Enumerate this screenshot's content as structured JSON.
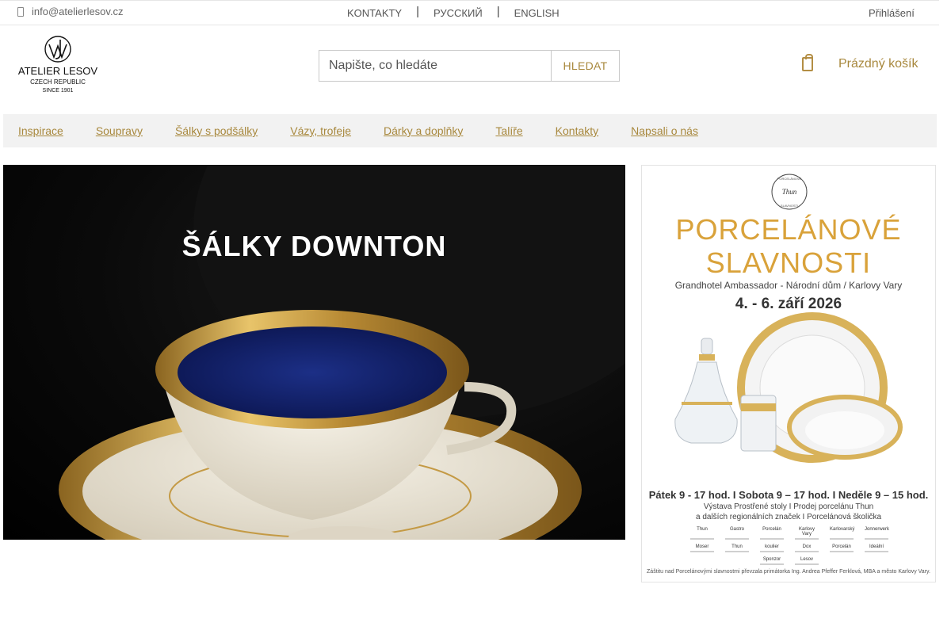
{
  "topbar": {
    "email": "info@atelierlesov.cz",
    "links": [
      "KONTAKTY",
      "РУССКИЙ",
      "ENGLISH"
    ],
    "login": "Přihlášení"
  },
  "logo": {
    "name": "ATELIER LESOV",
    "line2": "CZECH REPUBLIC",
    "line3": "SINCE 1901"
  },
  "search": {
    "placeholder": "Napište, co hledáte",
    "button": "HLEDAT"
  },
  "cart": {
    "label": "Prázdný košík"
  },
  "nav": [
    "Inspirace",
    "Soupravy",
    "Šálky s podšálky",
    "Vázy, trofeje",
    "Dárky a doplňky",
    "Talíře",
    "Kontakty",
    "Napsali o nás"
  ],
  "hero": {
    "title": "ŠÁLKY DOWNTON"
  },
  "poster": {
    "badge_line1": "PORCELÁNOVÉ",
    "badge_line2": "SLAVNOSTI",
    "badge_brand": "Thun",
    "title_line1": "PORCELÁNOVÉ",
    "title_line2": "SLAVNOSTI",
    "venue": "Grandhotel Ambassador - Národní dům / Karlovy Vary",
    "dates": "4. - 6. září 2026",
    "hours": "Pátek 9 - 17 hod. I Sobota 9 – 17 hod. I Neděle 9 – 15 hod.",
    "sub1": "Výstava Prostřené stoly I Prodej porcelánu Thun",
    "sub2": "a dalších regionálních značek I Porcelánová školička",
    "logos": [
      "Thun",
      "Gastro",
      "Porcelán",
      "Karlovy Vary",
      "Karlovarský",
      "Jonnerwerk",
      "Moser",
      "Thun",
      "koulier",
      "Dox",
      "Porcelán",
      "Ideální",
      "Sponzor",
      "Lesov"
    ],
    "footer": "Záštitu nad Porcelánovými slavnostmi převzala primátorka Ing. Andrea Pfeffer Ferklová, MBA a město Karlovy Vary."
  }
}
